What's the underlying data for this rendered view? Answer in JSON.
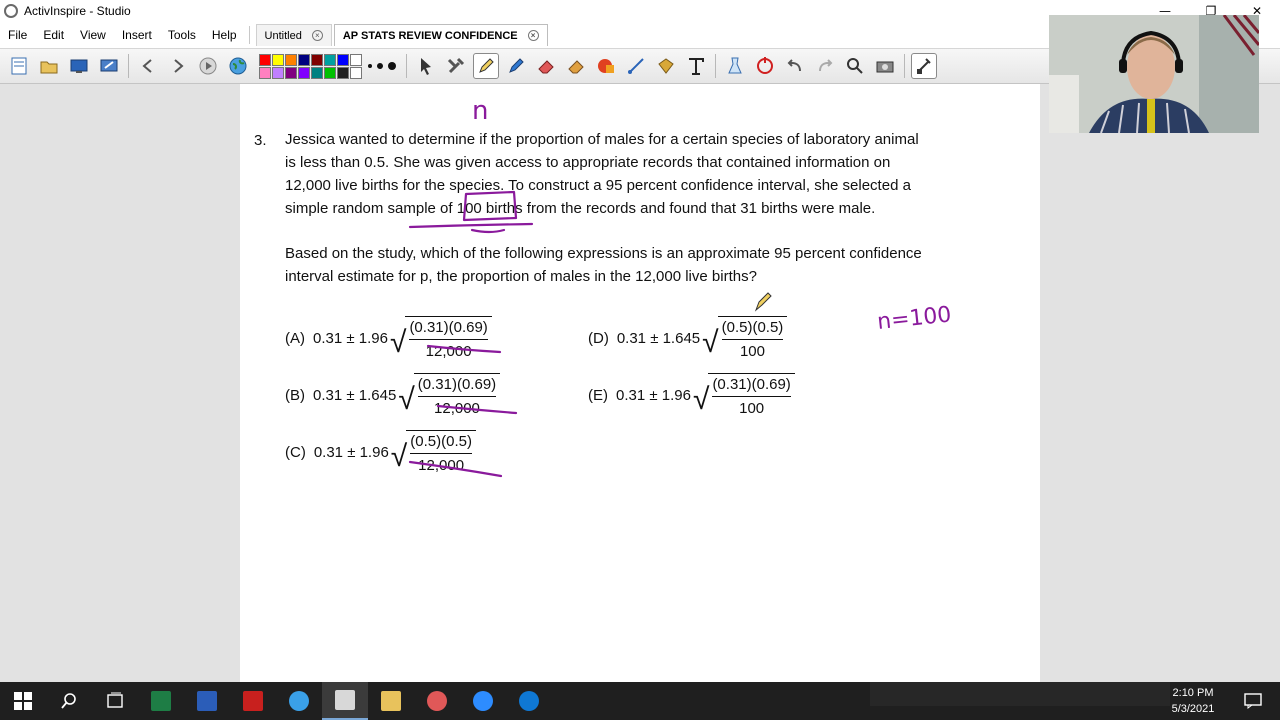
{
  "window": {
    "title": "ActivInspire - Studio",
    "minimize_glyph": "—",
    "restore_glyph": "❐",
    "close_glyph": "✕"
  },
  "menu": [
    "File",
    "Edit",
    "View",
    "Insert",
    "Tools",
    "Help"
  ],
  "tabs": [
    {
      "label": "Untitled",
      "active": false
    },
    {
      "label": "AP STATS REVIEW CONFIDENCE",
      "active": true
    }
  ],
  "tab_close_glyph": "×",
  "toolbar": {
    "palette_colors": [
      "#ff0000",
      "#ffff00",
      "#ff8000",
      "#000080",
      "#800000",
      "#00a0a0",
      "#0000ff",
      "#ffffff",
      "#ff80c0",
      "#c080ff",
      "#800080",
      "#8000ff",
      "#008080",
      "#00c000",
      "#202020",
      "#ffffff"
    ],
    "icons": [
      "flipchart-icon",
      "open-folder-icon",
      "desktop-icon",
      "annotate-desktop-icon",
      "previous-page-icon",
      "next-page-icon",
      "play-icon",
      "globe-icon",
      "select-icon",
      "tools-icon",
      "pen-icon",
      "highlighter-icon",
      "eraser-icon",
      "magic-ink-icon",
      "shape-icon",
      "connector-icon",
      "fill-icon",
      "text-icon",
      "clear-icon",
      "reset-icon",
      "undo-icon",
      "redo-icon",
      "zoom-icon",
      "camera-icon",
      "teacher-lock-icon"
    ]
  },
  "question": {
    "number": "3.",
    "lines": [
      "Jessica wanted to determine if the proportion of males for a certain species of laboratory animal",
      "is less than 0.5. She was given access to appropriate records that contained information on",
      "12,000 live births for the species. To construct a 95 percent confidence interval, she selected a",
      "simple random sample of 100 births from the records and found that 31 births were male."
    ],
    "prompt_lines": [
      "Based on the study, which of the following expressions is an approximate 95 percent confidence",
      "interval estimate for p, the proportion of males in the 12,000 live births?"
    ],
    "choices": [
      {
        "letter": "(A)",
        "coef": "0.31 ± 1.96",
        "num": "(0.31)(0.69)",
        "den": "12,000"
      },
      {
        "letter": "(B)",
        "coef": "0.31 ± 1.645",
        "num": "(0.31)(0.69)",
        "den": "12,000"
      },
      {
        "letter": "(C)",
        "coef": "0.31 ± 1.96",
        "num": "(0.5)(0.5)",
        "den": "12,000"
      },
      {
        "letter": "(D)",
        "coef": "0.31 ± 1.645",
        "num": "(0.5)(0.5)",
        "den": "100"
      },
      {
        "letter": "(E)",
        "coef": "0.31 ± 1.96",
        "num": "(0.31)(0.69)",
        "den": "100"
      }
    ],
    "radical_glyph": "√"
  },
  "annotations": {
    "handwriting_top": "n",
    "handwriting_right": "n=100",
    "ink_color": "#8a1a9c"
  },
  "taskbar": {
    "time": "2:10 PM",
    "date": "5/3/2021",
    "apps": [
      "windows-start-icon",
      "search-icon",
      "task-view-icon",
      "excel-icon",
      "word-icon",
      "acrobat-icon",
      "edge-legacy-icon",
      "activinspire-icon",
      "file-explorer-icon",
      "paint-icon",
      "zoom-icon",
      "edge-icon"
    ]
  }
}
